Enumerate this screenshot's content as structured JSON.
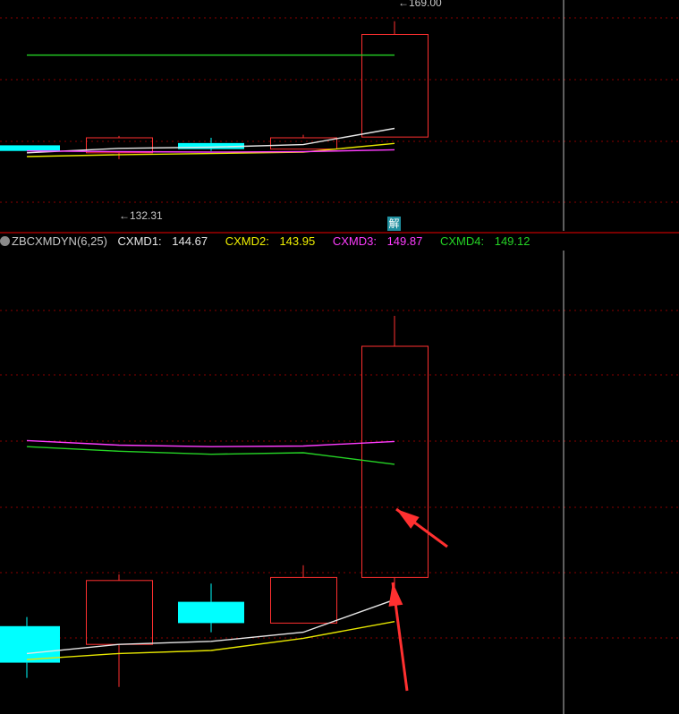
{
  "upper_panel": {
    "high_marker": "169.00",
    "low_marker": "132.31",
    "badge": "解"
  },
  "indicator_legend": {
    "name": "ZBCXMDYN(6,25)",
    "lines": [
      {
        "label": "CXMD1:",
        "value": "144.67",
        "color": "#e6e6e6"
      },
      {
        "label": "CXMD2:",
        "value": "143.95",
        "color": "#f0f000"
      },
      {
        "label": "CXMD3:",
        "value": "149.87",
        "color": "#ff3cff"
      },
      {
        "label": "CXMD4:",
        "value": "149.12",
        "color": "#25d425"
      }
    ]
  },
  "chart_data": [
    {
      "type": "candlestick",
      "panel": "price",
      "candles": [
        {
          "open": 136.0,
          "close": 134.5,
          "high": 136.0,
          "low": 134.5,
          "color": "#00ffff"
        },
        {
          "open": 134.0,
          "close": 138.0,
          "high": 138.5,
          "low": 132.31,
          "color": "#ff3030"
        },
        {
          "open": 136.6,
          "close": 135.0,
          "high": 138.0,
          "low": 134.5,
          "color": "#00ffff"
        },
        {
          "open": 135.0,
          "close": 138.0,
          "high": 138.8,
          "low": 135.0,
          "color": "#ff3030"
        },
        {
          "open": 138.2,
          "close": 165.5,
          "high": 169.0,
          "low": 138.2,
          "color": "#ff3030"
        }
      ],
      "lines": [
        {
          "name": "white",
          "color": "#e6e6e6",
          "values": [
            134.0,
            135.2,
            135.5,
            136.2,
            140.5
          ]
        },
        {
          "name": "yellow",
          "color": "#e6e600",
          "values": [
            133.0,
            133.5,
            133.8,
            134.2,
            136.5
          ]
        },
        {
          "name": "magenta",
          "color": "#ff3cff",
          "values": [
            134.5,
            134.3,
            134.2,
            134.3,
            134.8
          ]
        },
        {
          "name": "green",
          "color": "#25d425",
          "values": [
            160.0,
            160.0,
            160.0,
            160.0,
            160.0
          ]
        }
      ]
    },
    {
      "type": "candlestick",
      "panel": "indicator",
      "candles": [
        {
          "open": 143.8,
          "close": 142.6,
          "high": 144.1,
          "low": 142.1,
          "color": "#00ffff"
        },
        {
          "open": 143.2,
          "close": 145.3,
          "high": 145.5,
          "low": 141.8,
          "color": "#ff3030"
        },
        {
          "open": 144.6,
          "close": 143.9,
          "high": 145.2,
          "low": 143.6,
          "color": "#00ffff"
        },
        {
          "open": 143.9,
          "close": 145.4,
          "high": 145.8,
          "low": 143.9,
          "color": "#ff3030"
        },
        {
          "open": 145.4,
          "close": 153.0,
          "high": 154.0,
          "low": 145.0,
          "color": "#ff3030"
        }
      ],
      "lines": [
        {
          "name": "CXMD1",
          "color": "#e6e6e6",
          "values": [
            142.9,
            143.2,
            143.3,
            143.6,
            144.67
          ]
        },
        {
          "name": "CXMD2",
          "color": "#e6e600",
          "values": [
            142.7,
            142.9,
            143.0,
            143.4,
            143.95
          ]
        },
        {
          "name": "CXMD3",
          "color": "#ff3cff",
          "values": [
            149.9,
            149.75,
            149.7,
            149.72,
            149.87
          ]
        },
        {
          "name": "CXMD4",
          "color": "#25d425",
          "values": [
            149.7,
            149.55,
            149.45,
            149.5,
            149.12
          ]
        }
      ]
    }
  ],
  "colors": {
    "background": "#000000",
    "grid": "#8a0000",
    "separator": "#a00000",
    "arrow": "#ff3030"
  }
}
